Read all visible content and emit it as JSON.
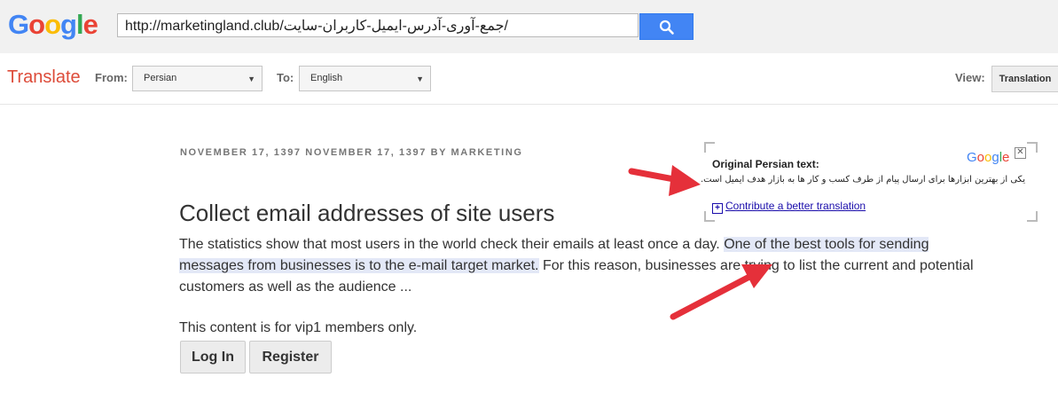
{
  "header": {
    "logo_letters": [
      "G",
      "o",
      "o",
      "g",
      "l",
      "e"
    ],
    "logo_colors": [
      "#4285f4",
      "#ea4335",
      "#fbbc05",
      "#4285f4",
      "#34a853",
      "#ea4335"
    ],
    "url_value": "http://marketingland.club/جمع-آوری-آدرس-ایمیل-کاربران-سایت/",
    "search_icon": "search-icon"
  },
  "translate_bar": {
    "title": "Translate",
    "from_label": "From:",
    "from_value": "Persian",
    "to_label": "To:",
    "to_value": "English",
    "view_label": "View:",
    "view_button": "Translation"
  },
  "article": {
    "meta": "NOVEMBER 17, 1397 NOVEMBER 17, 1397 BY MARKETING",
    "title": "Collect email addresses of site users",
    "para_part1": "The statistics show that most users in the world check their emails at least once a day. ",
    "para_highlight": "One of the best tools for sending messages from businesses is to the e-mail target market.",
    "para_part2": " For this reason, businesses are trying to list the current and potential customers as well as the audience ...",
    "vip_notice": "This content is for vip1 members only.",
    "login_button": "Log In",
    "register_button": "Register"
  },
  "popup": {
    "logo": "Google",
    "close_icon": "close-icon",
    "original_label": "Original Persian text:",
    "original_text": "یکی از بهترین ابزارها برای ارسال پیام از طرف کسب و کار ها به بازار هدف ایمیل است.",
    "contribute_link": "Contribute a better translation"
  },
  "colors": {
    "arrow": "#e5303a",
    "highlight": "#e3e8f7",
    "translate_red": "#dd4b39",
    "search_blue": "#4285f4"
  }
}
